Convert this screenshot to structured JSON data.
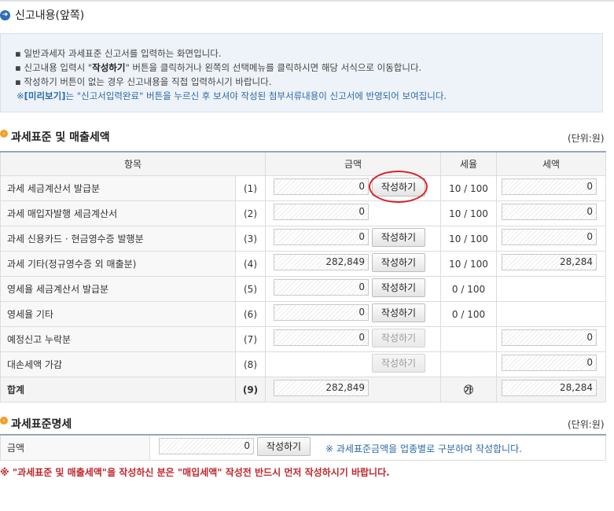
{
  "page_title": "신고내용(앞쪽)",
  "info": {
    "line1": "일반과세자 과세표준 신고서를 입력하는 화면입니다.",
    "line2_pre": "신고내용 입력시 \"",
    "line2_bold": "작성하기",
    "line2_post": "\" 버튼을 클릭하거나 왼쪽의 선택메뉴를 클릭하시면 해당 서식으로 이동합니다.",
    "line3": "작성하기 버튼이 없는 경우 신고내용을 직접 입력하시기 바랍니다.",
    "line4_pre": "※",
    "line4_bold": "[미리보기]",
    "line4_post": "는 \"신고서입력완료\" 버튼을 누르신 후 보셔야 작성된 첨부서류내용이 신고서에 반영되어 보여집니다.",
    "bullet": "▪"
  },
  "section1": {
    "title": "과세표준 및 매출세액",
    "unit": "(단위:원)"
  },
  "table": {
    "headers": [
      "항목",
      "금액",
      "세율",
      "세액"
    ],
    "rows": [
      {
        "label": "과세 세금계산서 발급분",
        "num": "(1)",
        "amount": "0",
        "button": "작성하기",
        "rate": "10 / 100",
        "tax": "0"
      },
      {
        "label": "과세 매입자발행 세금계산서",
        "num": "(2)",
        "amount": "0",
        "button": "",
        "rate": "10 / 100",
        "tax": "0"
      },
      {
        "label": "과세 신용카드 · 현금영수증 발행분",
        "num": "(3)",
        "amount": "0",
        "button": "작성하기",
        "rate": "10 / 100",
        "tax": "0"
      },
      {
        "label": "과세 기타(정규영수증 외 매출분)",
        "num": "(4)",
        "amount": "282,849",
        "button": "작성하기",
        "rate": "10 / 100",
        "tax": "28,284"
      },
      {
        "label": "영세율 세금계산서 발급분",
        "num": "(5)",
        "amount": "0",
        "button": "작성하기",
        "rate": "0 / 100",
        "tax": ""
      },
      {
        "label": "영세율 기타",
        "num": "(6)",
        "amount": "0",
        "button": "작성하기",
        "rate": "0 / 100",
        "tax": ""
      },
      {
        "label": "예정신고 누락분",
        "num": "(7)",
        "amount": "0",
        "button": "작성하기",
        "rate": "",
        "tax": "0"
      },
      {
        "label": "대손세액 가감",
        "num": "(8)",
        "amount": "",
        "button": "작성하기",
        "rate": "",
        "tax": "0"
      },
      {
        "label": "합계",
        "num": "(9)",
        "amount": "282,849",
        "button": "",
        "rate": "㉮",
        "tax": "28,284"
      }
    ]
  },
  "section2": {
    "title": "과세표준명세",
    "unit": "(단위:원)",
    "label": "금액",
    "amount": "0",
    "button": "작성하기",
    "note": "※ 과세표준금액을 업종별로 구분하여 작성합니다."
  },
  "warning": "※ \"과세표준 및 매출세액\"을 작성하신 분은 \"매입세액\" 작성전 반드시 먼저 작성하시기 바랍니다.",
  "colors": {
    "accent_blue": "#2f6db5",
    "orange": "#f29e2c",
    "warning_red": "#c0262d",
    "highlight_ring": "#d8232a"
  },
  "icons": {
    "title_icon": "circle-arrow-icon",
    "section_icon": "orange-dot-icon"
  }
}
